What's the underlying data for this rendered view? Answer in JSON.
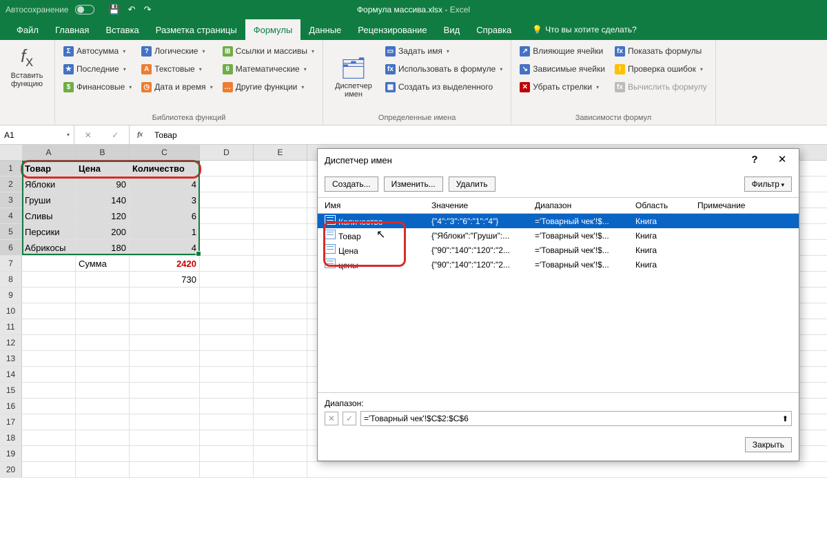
{
  "titlebar": {
    "autosave": "Автосохранение",
    "doc": "Формула массива.xlsx",
    "app": "Excel"
  },
  "tabs": [
    "Файл",
    "Главная",
    "Вставка",
    "Разметка страницы",
    "Формулы",
    "Данные",
    "Рецензирование",
    "Вид",
    "Справка"
  ],
  "active_tab": 4,
  "tell_me": "Что вы хотите сделать?",
  "ribbon": {
    "insert_fn": "Вставить функцию",
    "library_title": "Библиотека функций",
    "lib": {
      "autosum": "Автосумма",
      "recent": "Последние",
      "financial": "Финансовые",
      "logical": "Логические",
      "text": "Текстовые",
      "datetime": "Дата и время",
      "lookup": "Ссылки и массивы",
      "math": "Математические",
      "more": "Другие функции"
    },
    "name_mgr": "Диспетчер имен",
    "names_title": "Определенные имена",
    "names": {
      "define": "Задать имя",
      "use": "Использовать в формуле",
      "create": "Создать из выделенного"
    },
    "audit_title": "Зависимости формул",
    "audit": {
      "precedents": "Влияющие ячейки",
      "dependents": "Зависимые ячейки",
      "remove_arrows": "Убрать стрелки",
      "show_formulas": "Показать формулы",
      "error_check": "Проверка ошибок",
      "evaluate": "Вычислить формулу"
    }
  },
  "namebox": "A1",
  "formula_value": "Товар",
  "columns": [
    "A",
    "B",
    "C",
    "D",
    "E"
  ],
  "rows": [
    {
      "n": 1,
      "a": "Товар",
      "b": "Цена",
      "c": "Количество"
    },
    {
      "n": 2,
      "a": "Яблоки",
      "b": "90",
      "c": "4"
    },
    {
      "n": 3,
      "a": "Груши",
      "b": "140",
      "c": "3"
    },
    {
      "n": 4,
      "a": "Сливы",
      "b": "120",
      "c": "6"
    },
    {
      "n": 5,
      "a": "Персики",
      "b": "200",
      "c": "1"
    },
    {
      "n": 6,
      "a": "Абрикосы",
      "b": "180",
      "c": "4"
    },
    {
      "n": 7,
      "a": "",
      "b": "Сумма",
      "c": "2420"
    },
    {
      "n": 8,
      "a": "",
      "b": "",
      "c": "730"
    }
  ],
  "dialog": {
    "title": "Диспетчер имен",
    "buttons": {
      "new": "Создать...",
      "edit": "Изменить...",
      "del": "Удалить",
      "filter": "Фильтр"
    },
    "cols": {
      "name": "Имя",
      "value": "Значение",
      "range": "Диапазон",
      "scope": "Область",
      "note": "Примечание"
    },
    "items": [
      {
        "name": "Количество",
        "value": "{\"4\":\"3\":\"6\":\"1\":\"4\"}",
        "range": "='Товарный чек'!$...",
        "scope": "Книга"
      },
      {
        "name": "Товар",
        "value": "{\"Яблоки\":\"Груши\":...",
        "range": "='Товарный чек'!$...",
        "scope": "Книга"
      },
      {
        "name": "Цена",
        "value": "{\"90\":\"140\":\"120\":\"2...",
        "range": "='Товарный чек'!$...",
        "scope": "Книга"
      },
      {
        "name": "цены",
        "value": "{\"90\":\"140\":\"120\":\"2...",
        "range": "='Товарный чек'!$...",
        "scope": "Книга"
      }
    ],
    "range_label": "Диапазон:",
    "range_value": "='Товарный чек'!$C$2:$C$6",
    "close": "Закрыть"
  }
}
